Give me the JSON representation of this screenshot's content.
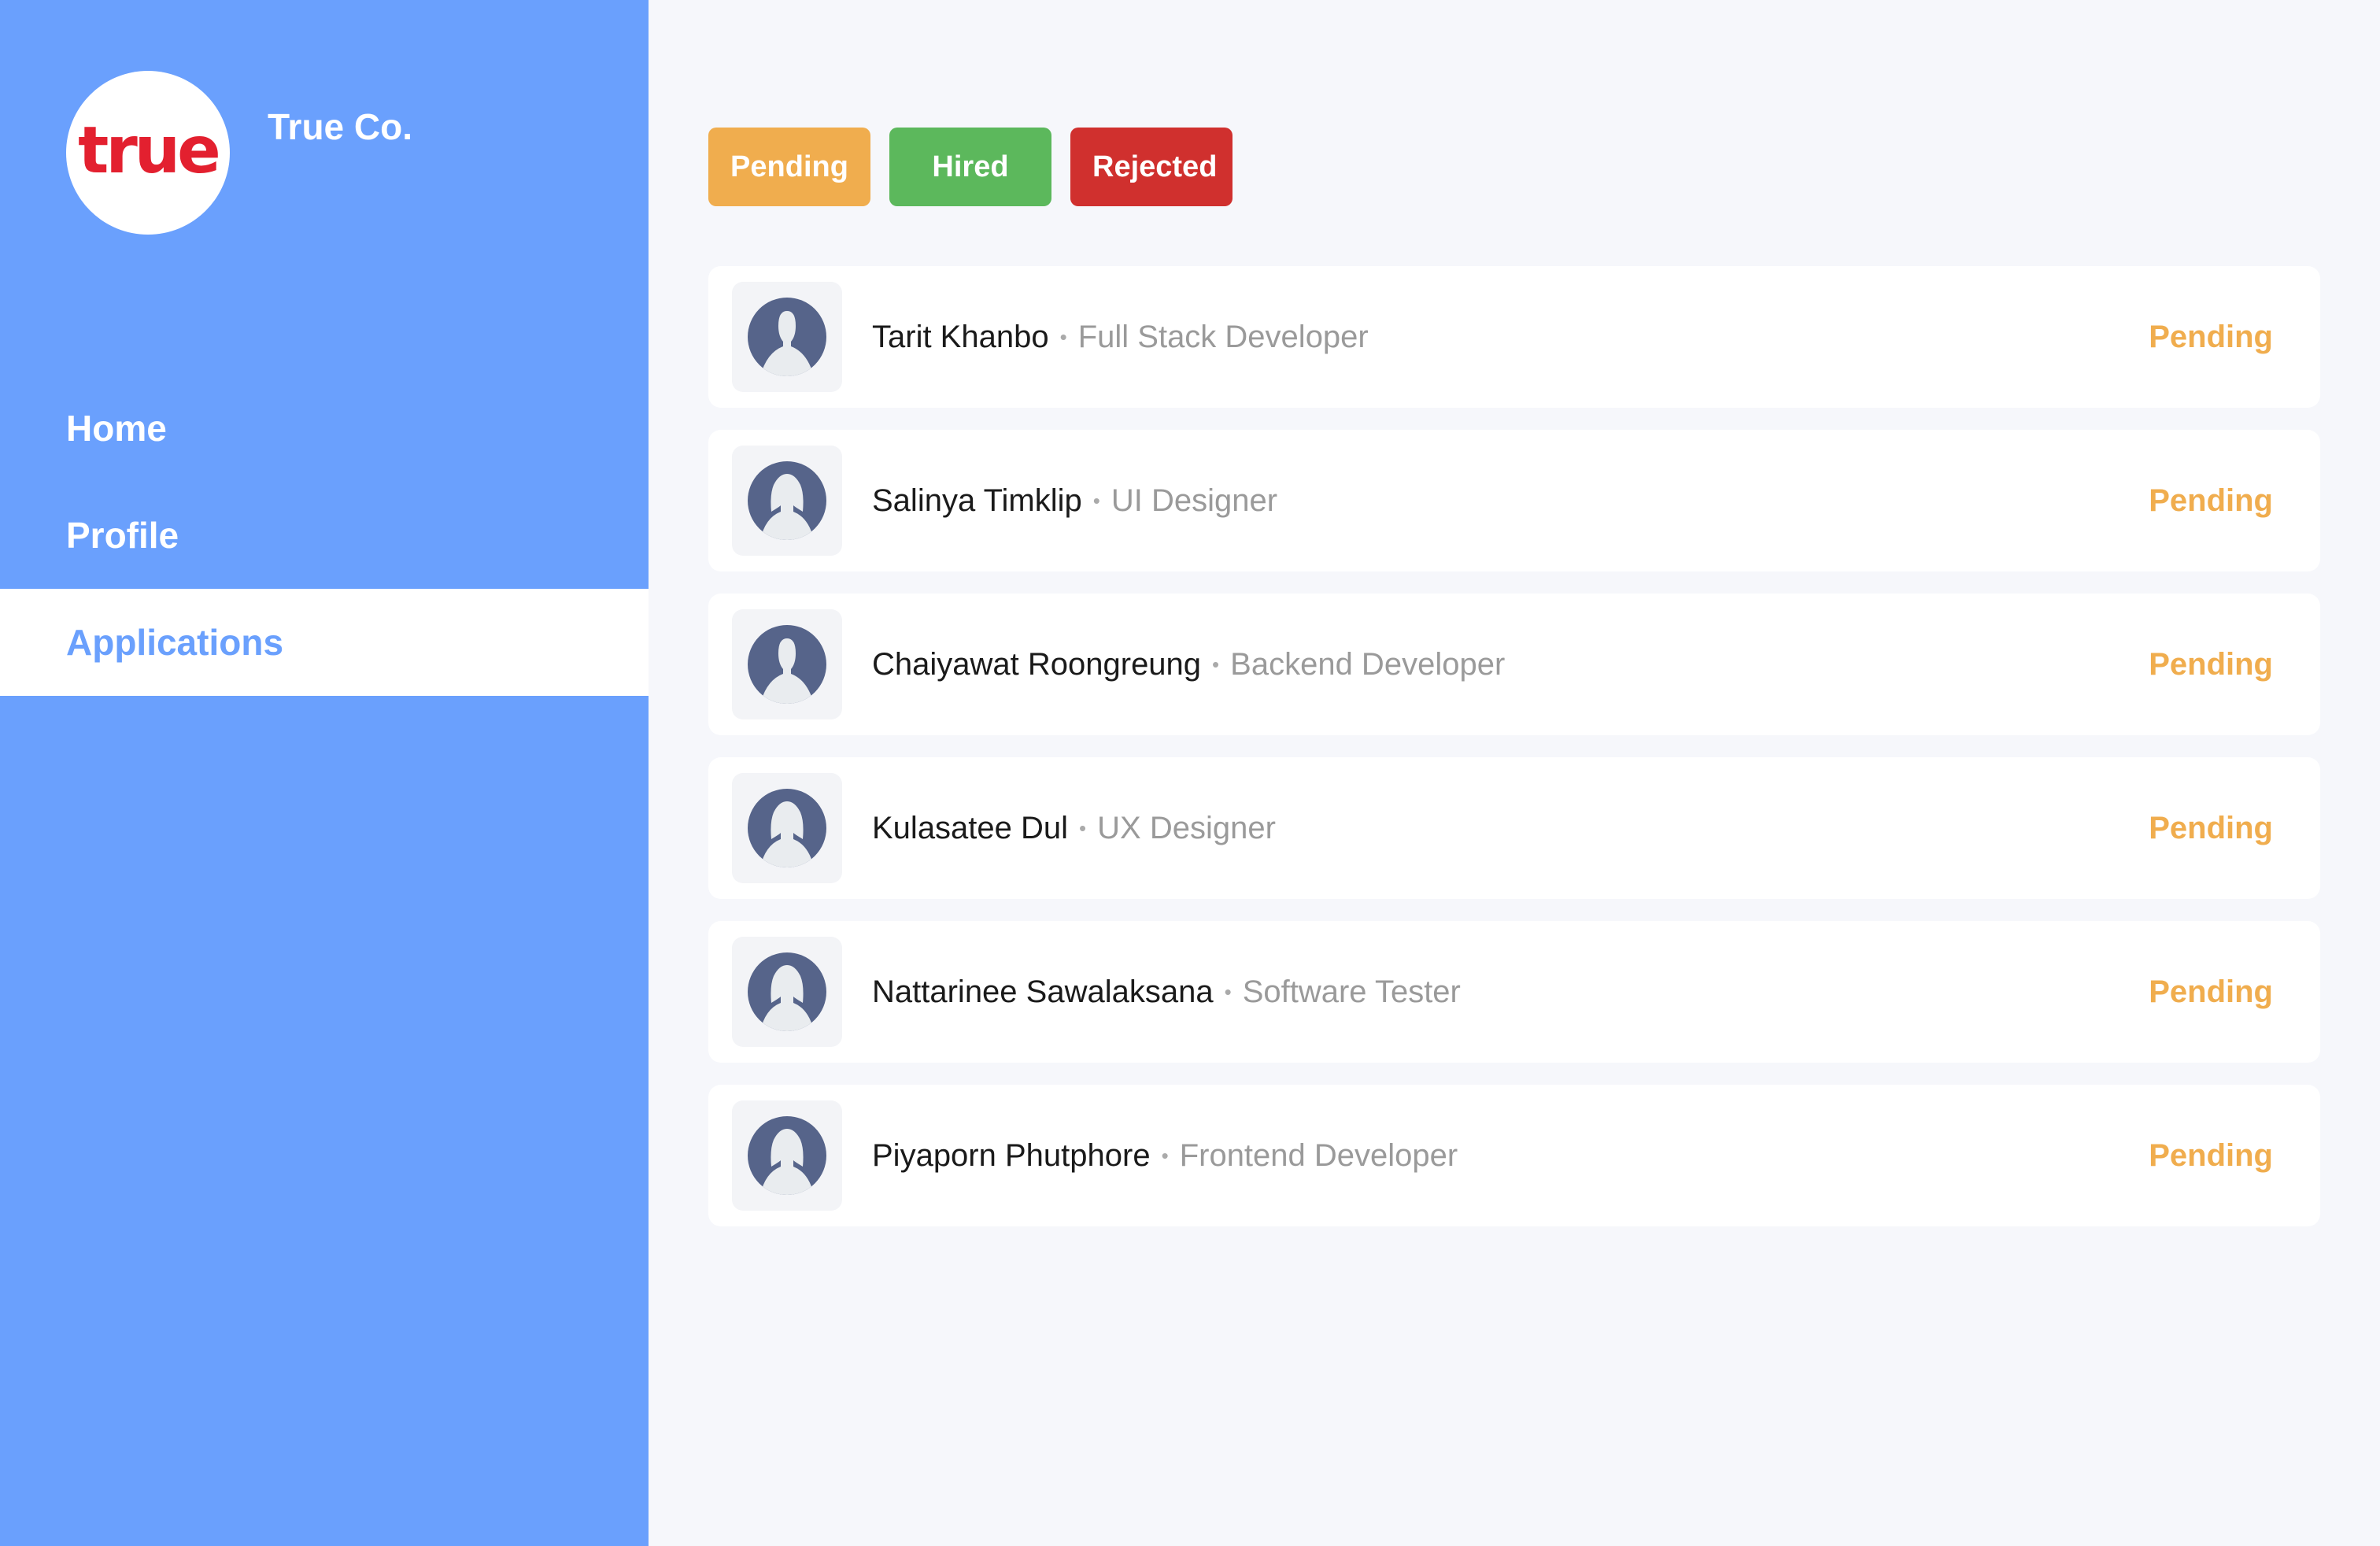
{
  "brand": {
    "logo_text": "true",
    "company_name": "True Co."
  },
  "nav": [
    {
      "label": "Home",
      "active": false
    },
    {
      "label": "Profile",
      "active": false
    },
    {
      "label": "Applications",
      "active": true
    }
  ],
  "filters": {
    "pending_label": "Pending",
    "hired_label": "Hired",
    "rejected_label": "Rejected"
  },
  "separator": "•",
  "applications": [
    {
      "name": "Tarit Khanbo",
      "role": "Full Stack Developer",
      "status": "Pending",
      "avatar": "male-avatar-icon"
    },
    {
      "name": "Salinya Timklip",
      "role": "UI Designer",
      "status": "Pending",
      "avatar": "female-avatar-icon"
    },
    {
      "name": "Chaiyawat Roongreung",
      "role": "Backend Developer",
      "status": "Pending",
      "avatar": "male-avatar-icon"
    },
    {
      "name": "Kulasatee Dul",
      "role": "UX Designer",
      "status": "Pending",
      "avatar": "female-avatar-icon"
    },
    {
      "name": "Nattarinee Sawalaksana",
      "role": "Software Tester",
      "status": "Pending",
      "avatar": "female-avatar-icon"
    },
    {
      "name": "Piyaporn Phutphore",
      "role": "Frontend Developer",
      "status": "Pending",
      "avatar": "female-avatar-icon"
    }
  ],
  "colors": {
    "sidebar": "#6aa0fd",
    "pending": "#f0ad4e",
    "hired": "#5cb85c",
    "rejected": "#d0302e",
    "logo_red": "#e3202f",
    "avatar_fill": "#56648a"
  }
}
